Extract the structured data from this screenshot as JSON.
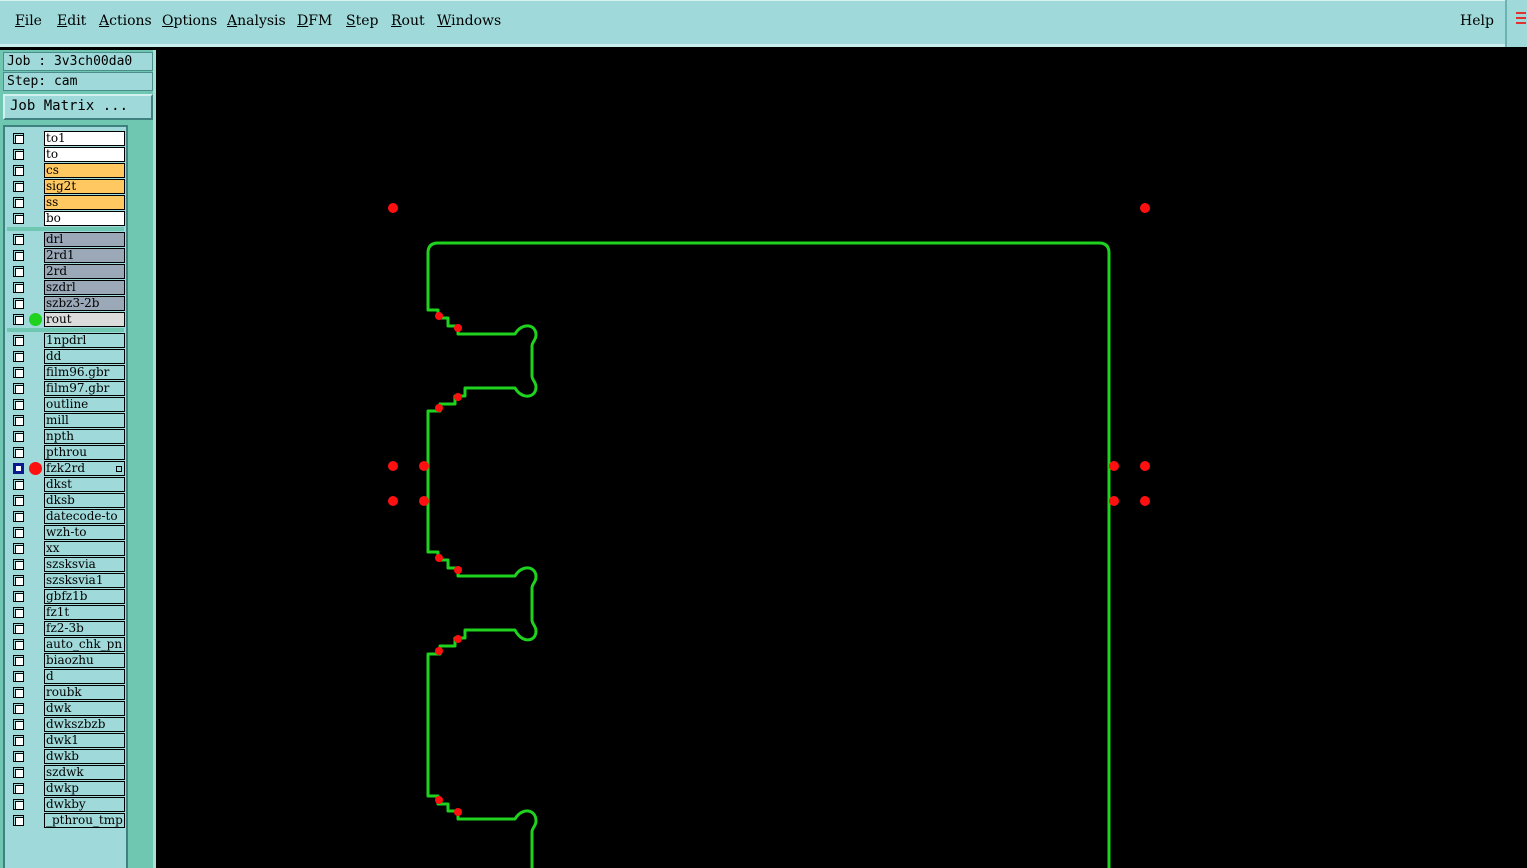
{
  "menubar": {
    "items": [
      {
        "label": "File",
        "mnemonic": "F"
      },
      {
        "label": "Edit",
        "mnemonic": "E"
      },
      {
        "label": "Actions",
        "mnemonic": "A"
      },
      {
        "label": "Options",
        "mnemonic": "O"
      },
      {
        "label": "Analysis",
        "mnemonic": "A"
      },
      {
        "label": "DFM",
        "mnemonic": "D"
      },
      {
        "label": "Step",
        "mnemonic": "S"
      },
      {
        "label": "Rout",
        "mnemonic": "R"
      },
      {
        "label": "Windows",
        "mnemonic": "W"
      }
    ],
    "help": "Help"
  },
  "job": {
    "job_label": "Job : 3v3ch00da0",
    "step_label": "Step: cam",
    "job_matrix_button": "Job Matrix ..."
  },
  "colors": {
    "menubar_bg": "#9fd9d9",
    "panel_bg": "#6fc7b2",
    "board_layer": "#ffc860",
    "drill_layer": "#9aa8b8",
    "misc_layer": "#9fd9d9",
    "outline": "#1ed21e",
    "drill_points": "#ff1010"
  },
  "layers": {
    "board": [
      {
        "name": "to1",
        "color": "#ffffff"
      },
      {
        "name": "to",
        "color": "#ffffff"
      },
      {
        "name": "cs",
        "color": "#ffc860"
      },
      {
        "name": "sig2t",
        "color": "#ffc860"
      },
      {
        "name": "ss",
        "color": "#ffc860"
      },
      {
        "name": "bo",
        "color": "#ffffff"
      }
    ],
    "drill": [
      {
        "name": "drl",
        "color": "#9aa8b8"
      },
      {
        "name": "2rd1",
        "color": "#9aa8b8"
      },
      {
        "name": "2rd",
        "color": "#9aa8b8"
      },
      {
        "name": "szdrl",
        "color": "#9aa8b8"
      },
      {
        "name": "szbz3-2b",
        "color": "#9aa8b8"
      },
      {
        "name": "rout",
        "color": "#dcdcdc",
        "display_color": "#1ed21e"
      }
    ],
    "misc": [
      {
        "name": "1npdrl"
      },
      {
        "name": "dd"
      },
      {
        "name": "film96.gbr"
      },
      {
        "name": "film97.gbr"
      },
      {
        "name": "outline"
      },
      {
        "name": "mill"
      },
      {
        "name": "npth"
      },
      {
        "name": "pthrou"
      },
      {
        "name": "fzk2rd",
        "display_color": "#ff1010",
        "work": true
      },
      {
        "name": "dkst"
      },
      {
        "name": "dksb"
      },
      {
        "name": "datecode-to"
      },
      {
        "name": "wzh-to"
      },
      {
        "name": "xx"
      },
      {
        "name": "szsksvia"
      },
      {
        "name": "szsksvia1"
      },
      {
        "name": "gbfz1b"
      },
      {
        "name": "fz1t"
      },
      {
        "name": "fz2-3b"
      },
      {
        "name": "auto_chk_pn"
      },
      {
        "name": "biaozhu"
      },
      {
        "name": "d"
      },
      {
        "name": "roubk"
      },
      {
        "name": "dwk"
      },
      {
        "name": "dwkszbzb"
      },
      {
        "name": "dwk1"
      },
      {
        "name": "dwkb"
      },
      {
        "name": "szdwk"
      },
      {
        "name": "dwkp"
      },
      {
        "name": "dwkby"
      },
      {
        "name": "_pthrou_tmp"
      }
    ]
  }
}
